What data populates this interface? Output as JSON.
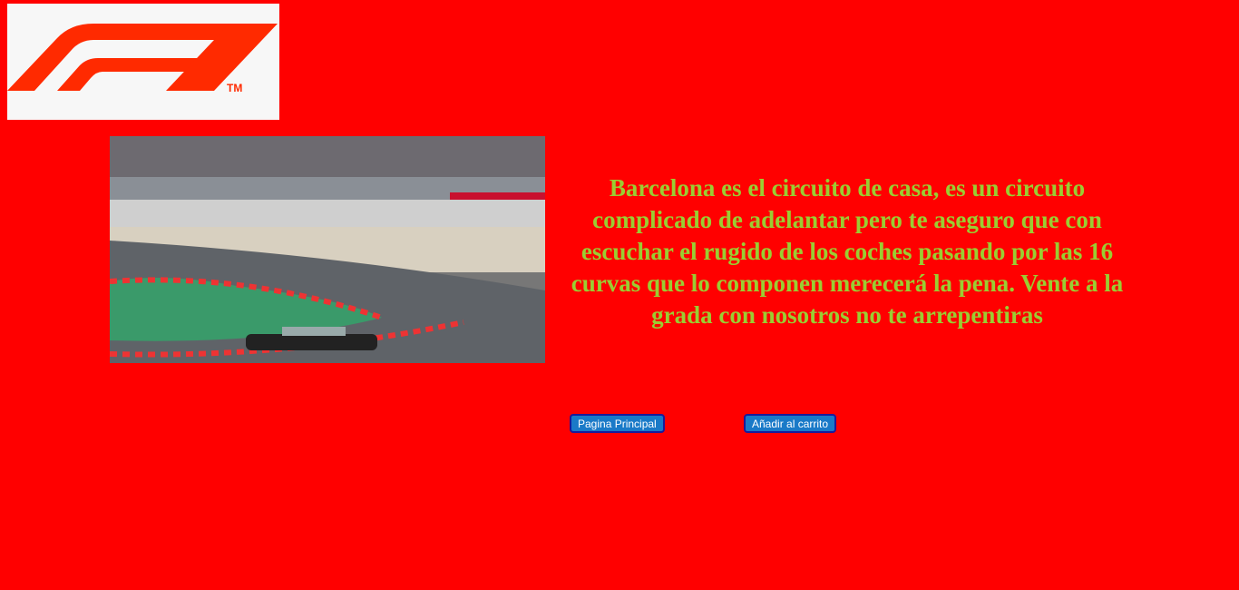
{
  "logo": {
    "alt": "F1",
    "trademark": "TM",
    "color": "#ff2a00"
  },
  "description": "Barcelona es el circuito de casa, es un circuito complicado de adelantar pero te aseguro que con escuchar el rugido de los coches pasando por las 16 curvas que lo componen merecerá la pena. Vente a la grada con nosotros no te arrepentiras",
  "buttons": {
    "home": "Pagina Principal",
    "cart": "Añadir al carrito"
  },
  "colors": {
    "background": "#ff0000",
    "text": "#9acd32",
    "button": "#1a7ac8"
  }
}
